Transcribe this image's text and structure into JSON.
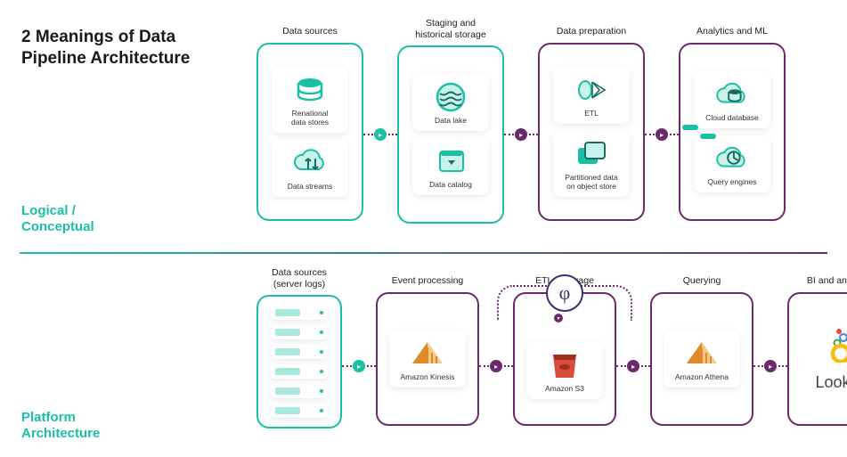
{
  "title": "2 Meanings of Data\nPipeline Architecture",
  "sidelabels": {
    "logical": "Logical /\nConceptual",
    "platform": "Platform\nArchitecture"
  },
  "row1": {
    "stages": [
      {
        "header": "Data sources",
        "tiles": [
          {
            "icon": "db",
            "label": "Renational\ndata stores"
          },
          {
            "icon": "cloud-arrows",
            "label": "Data streams"
          }
        ]
      },
      {
        "header": "Staging and\nhistorical storage",
        "tiles": [
          {
            "icon": "lake",
            "label": "Data lake"
          },
          {
            "icon": "catalog",
            "label": "Data catalog"
          }
        ]
      },
      {
        "header": "Data preparation",
        "tiles": [
          {
            "icon": "etl",
            "label": "ETL"
          },
          {
            "icon": "partition",
            "label": "Partitioned data\non object store"
          }
        ]
      },
      {
        "header": "Analytics and ML",
        "tiles": [
          {
            "icon": "cloud-db",
            "label": "Cloud database"
          },
          {
            "icon": "cloud-query",
            "label": "Query engines"
          }
        ]
      }
    ]
  },
  "row2": {
    "stages": [
      {
        "header": "Data sources\n(server logs)",
        "kind": "servers",
        "count": 6
      },
      {
        "header": "Event processing",
        "tiles": [
          {
            "icon": "kinesis",
            "label": "Amazon Kinesis"
          }
        ]
      },
      {
        "header": "ETL + storage",
        "phi": true,
        "loop": true,
        "tiles": [
          {
            "icon": "s3",
            "label": "Amazon S3"
          }
        ]
      },
      {
        "header": "Querying",
        "tiles": [
          {
            "icon": "athena",
            "label": "Amazon Athena"
          }
        ]
      },
      {
        "header": "BI and analytics",
        "kind": "looker",
        "logo": "Looker"
      }
    ]
  }
}
